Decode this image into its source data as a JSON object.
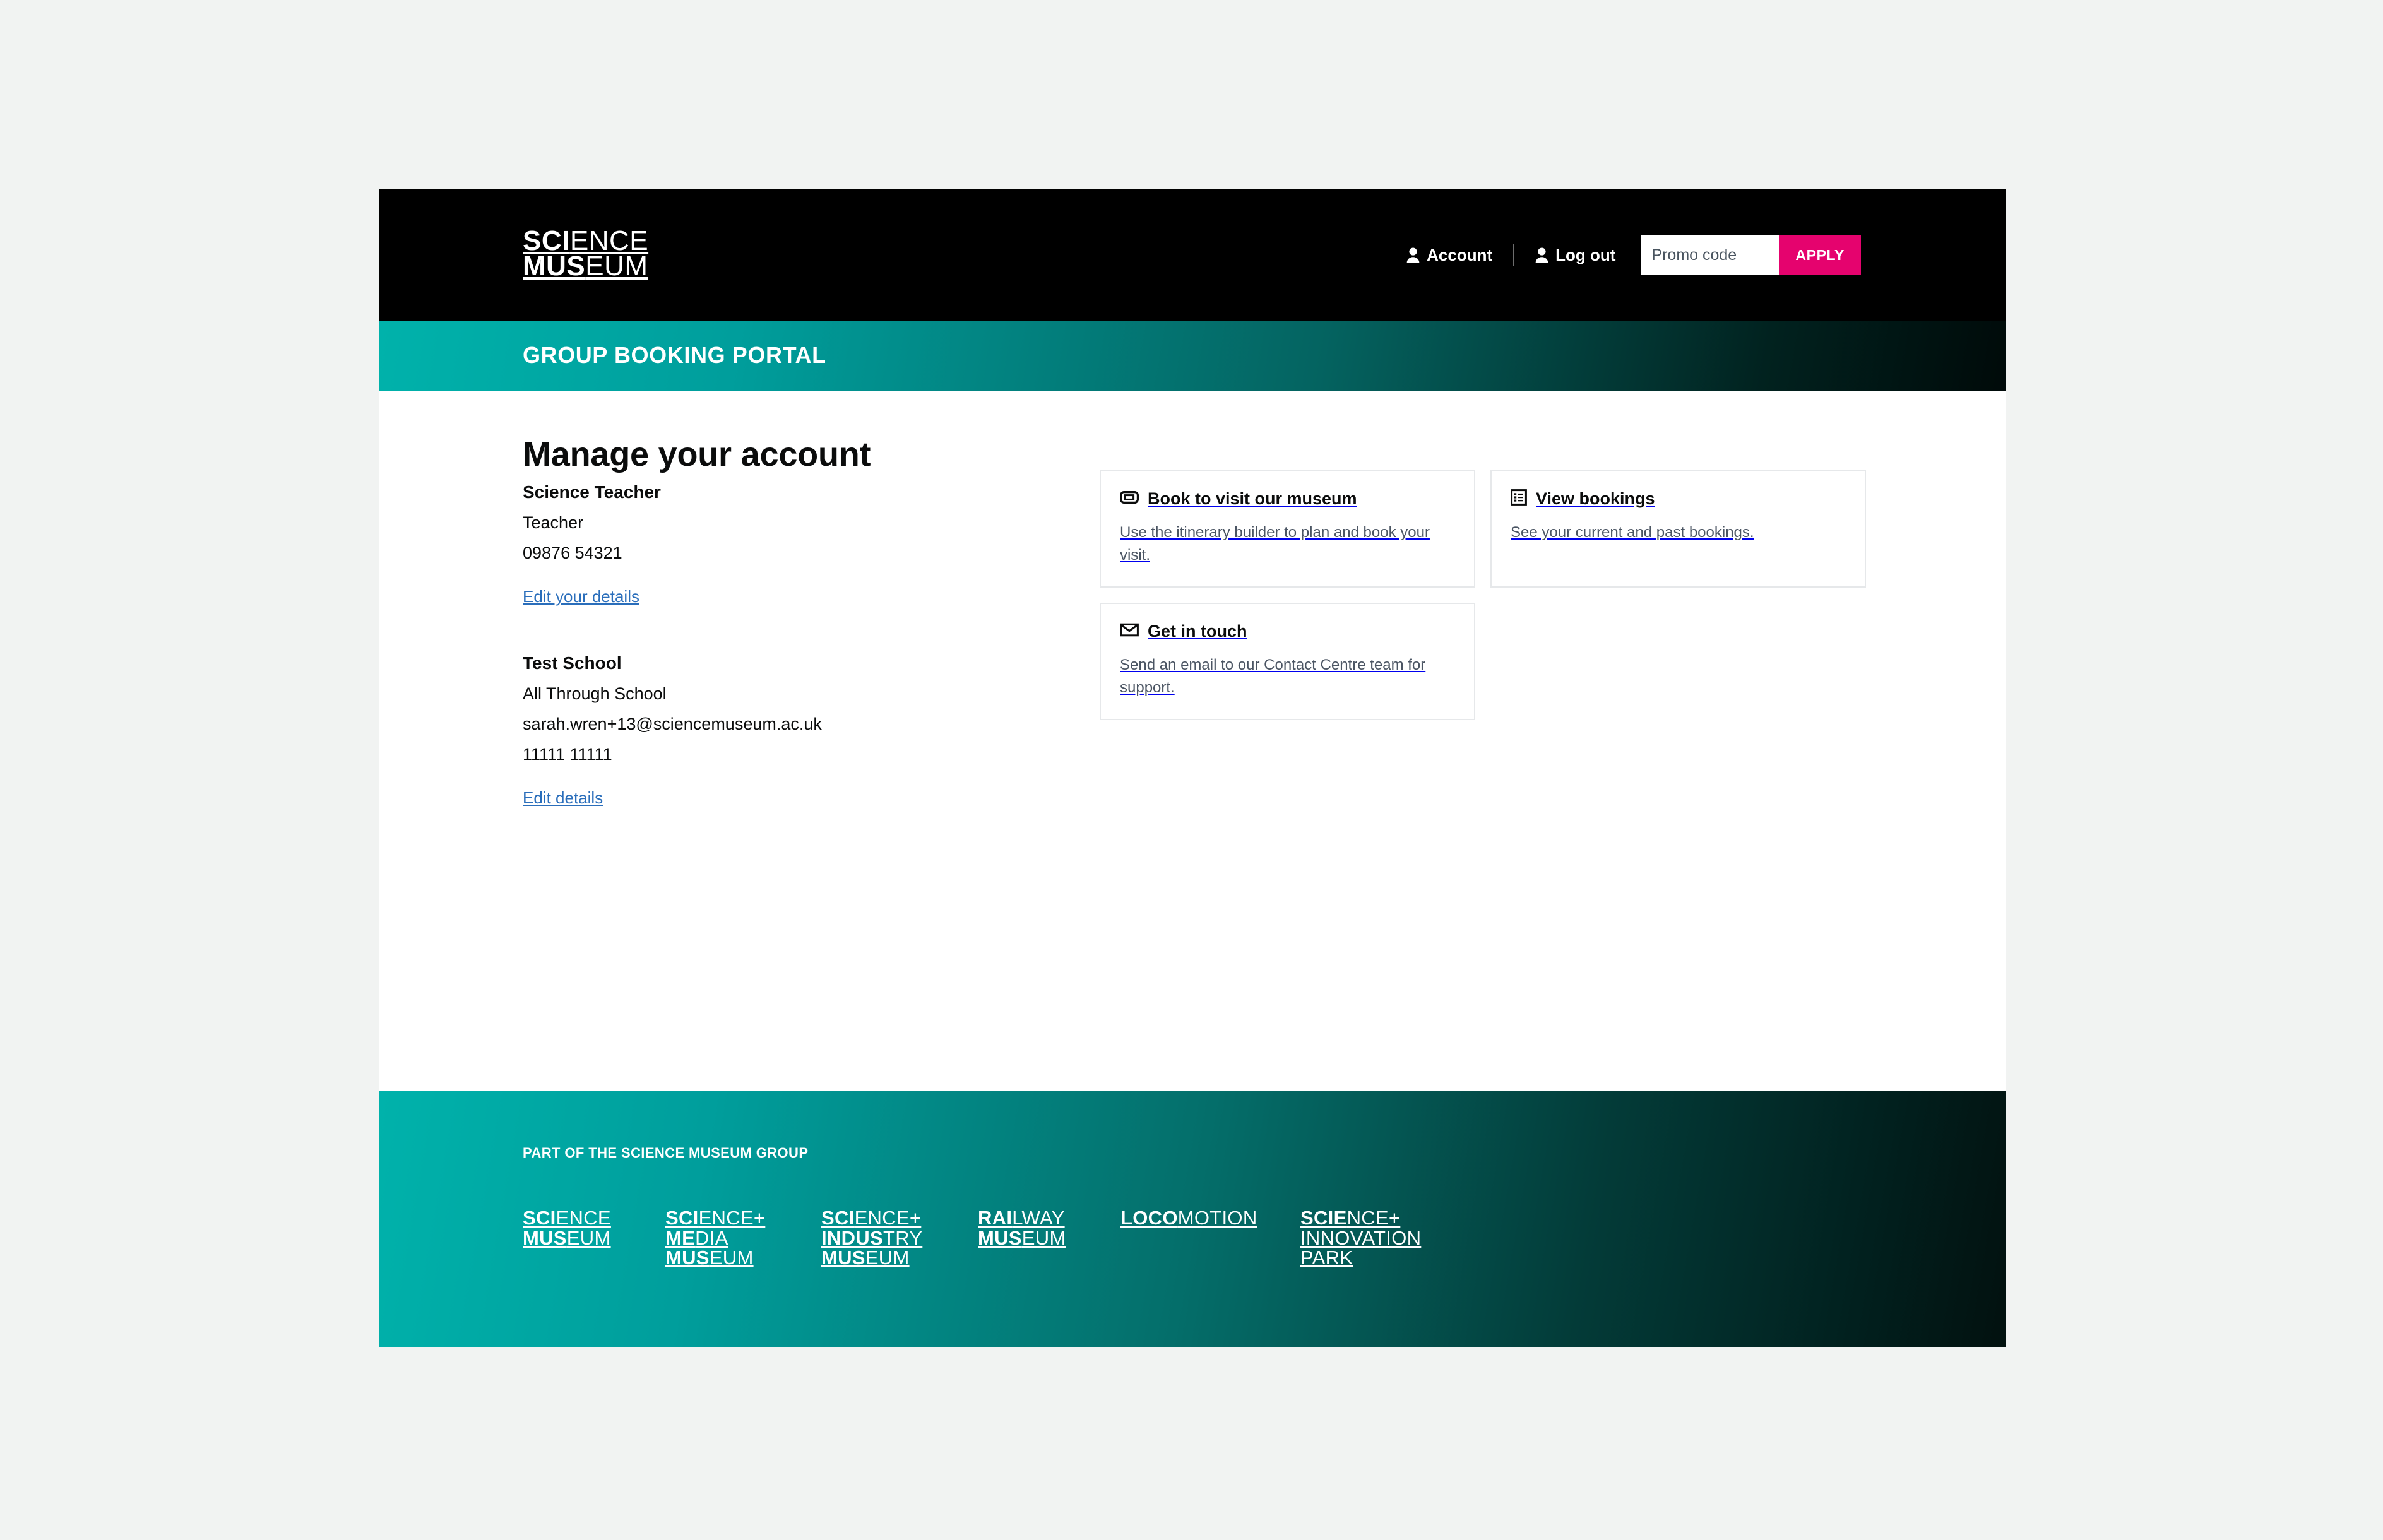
{
  "header": {
    "logo": {
      "line1_bold": "SCI",
      "line1_light": "ENCE",
      "line2_bold": "MUS",
      "line2_light": "EUM"
    },
    "account_label": "Account",
    "logout_label": "Log out",
    "promo_placeholder": "Promo code",
    "promo_value": "",
    "apply_label": "APPLY",
    "bg_color": "#000000",
    "apply_color": "#e5036e"
  },
  "banner": {
    "title": "GROUP BOOKING PORTAL",
    "gradient_from": "#00b2ab",
    "gradient_to": "#000a09"
  },
  "main": {
    "page_title": "Manage your account",
    "person": {
      "name": "Science Teacher",
      "role": "Teacher",
      "phone": "09876 54321",
      "edit_link": "Edit your details"
    },
    "organisation": {
      "name": "Test School",
      "type": "All Through School",
      "email": "sarah.wren+13@sciencemuseum.ac.uk",
      "phone": "11111 11111",
      "edit_link": "Edit details"
    },
    "cards": [
      {
        "icon": "ticket-icon",
        "title": "Book to visit our museum",
        "desc": "Use the itinerary builder to plan and book your visit."
      },
      {
        "icon": "list-icon",
        "title": "View bookings",
        "desc": "See your current and past bookings."
      },
      {
        "icon": "envelope-icon",
        "title": "Get in touch",
        "desc": "Send an email to our Contact Centre team for support."
      }
    ]
  },
  "footer": {
    "strapline": "PART OF THE SCIENCE MUSEUM GROUP",
    "gradient_from": "#00b2ab",
    "gradient_to": "#02110f",
    "logos": [
      {
        "lines": [
          {
            "b": "SCI",
            "l": "ENCE"
          },
          {
            "b": "MUS",
            "l": "EUM"
          }
        ]
      },
      {
        "lines": [
          {
            "b": "SCI",
            "l": "ENCE+"
          },
          {
            "b": "ME",
            "l": "DIA"
          },
          {
            "b": "MUS",
            "l": "EUM"
          }
        ]
      },
      {
        "lines": [
          {
            "b": "SCI",
            "l": "ENCE+"
          },
          {
            "b": "INDUS",
            "l": "TRY"
          },
          {
            "b": "MUS",
            "l": "EUM"
          }
        ]
      },
      {
        "lines": [
          {
            "b": "RAI",
            "l": "LWAY"
          },
          {
            "b": "MUS",
            "l": "EUM"
          }
        ]
      },
      {
        "lines": [
          {
            "b": "LOCO",
            "l": "MOTION"
          }
        ]
      },
      {
        "lines": [
          {
            "b": "SCIE",
            "l": "NCE+"
          },
          {
            "b": "",
            "l": "INNOVATION"
          },
          {
            "b": "",
            "l": "PARK"
          }
        ]
      }
    ]
  }
}
